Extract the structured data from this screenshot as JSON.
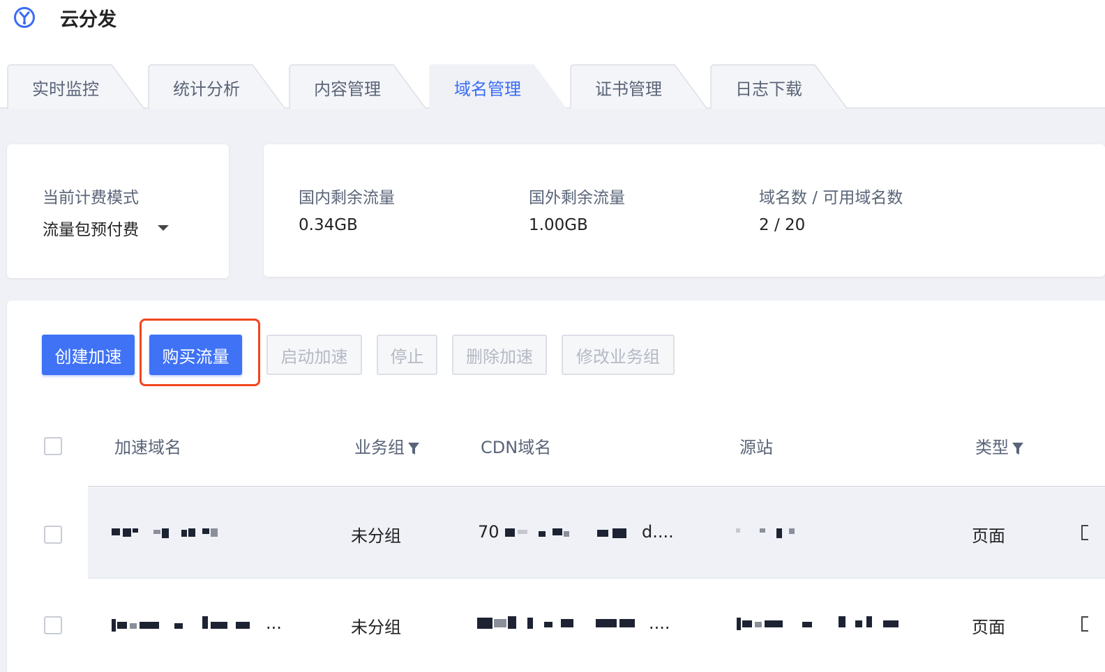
{
  "app": {
    "title": "云分发",
    "logo_icon": "cloud-distribution-logo-icon"
  },
  "tabs": [
    {
      "label": "实时监控",
      "active": false
    },
    {
      "label": "统计分析",
      "active": false
    },
    {
      "label": "内容管理",
      "active": false
    },
    {
      "label": "域名管理",
      "active": true
    },
    {
      "label": "证书管理",
      "active": false
    },
    {
      "label": "日志下载",
      "active": false
    }
  ],
  "billing": {
    "label": "当前计费模式",
    "value": "流量包预付费"
  },
  "stats": {
    "domestic_label": "国内剩余流量",
    "domestic_value": "0.34GB",
    "overseas_label": "国外剩余流量",
    "overseas_value": "1.00GB",
    "domains_label": "域名数 / 可用域名数",
    "domains_value": "2 / 20"
  },
  "toolbar": {
    "create": "创建加速",
    "buy": "购买流量",
    "start": "启动加速",
    "stop": "停止",
    "delete": "删除加速",
    "modify_group": "修改业务组"
  },
  "table": {
    "headers": {
      "domain": "加速域名",
      "group": "业务组",
      "cdn": "CDN域名",
      "origin": "源站",
      "type": "类型"
    },
    "rows": [
      {
        "group": "未分组",
        "cdn_prefix": "70",
        "cdn_suffix": "d....",
        "type": "页面"
      },
      {
        "domain_suffix": "...",
        "group": "未分组",
        "cdn_suffix": "....",
        "type": "页面"
      }
    ]
  },
  "colors": {
    "accent": "#3f72f5",
    "highlight": "#f0451f",
    "panel_bg": "#eff1f7"
  }
}
